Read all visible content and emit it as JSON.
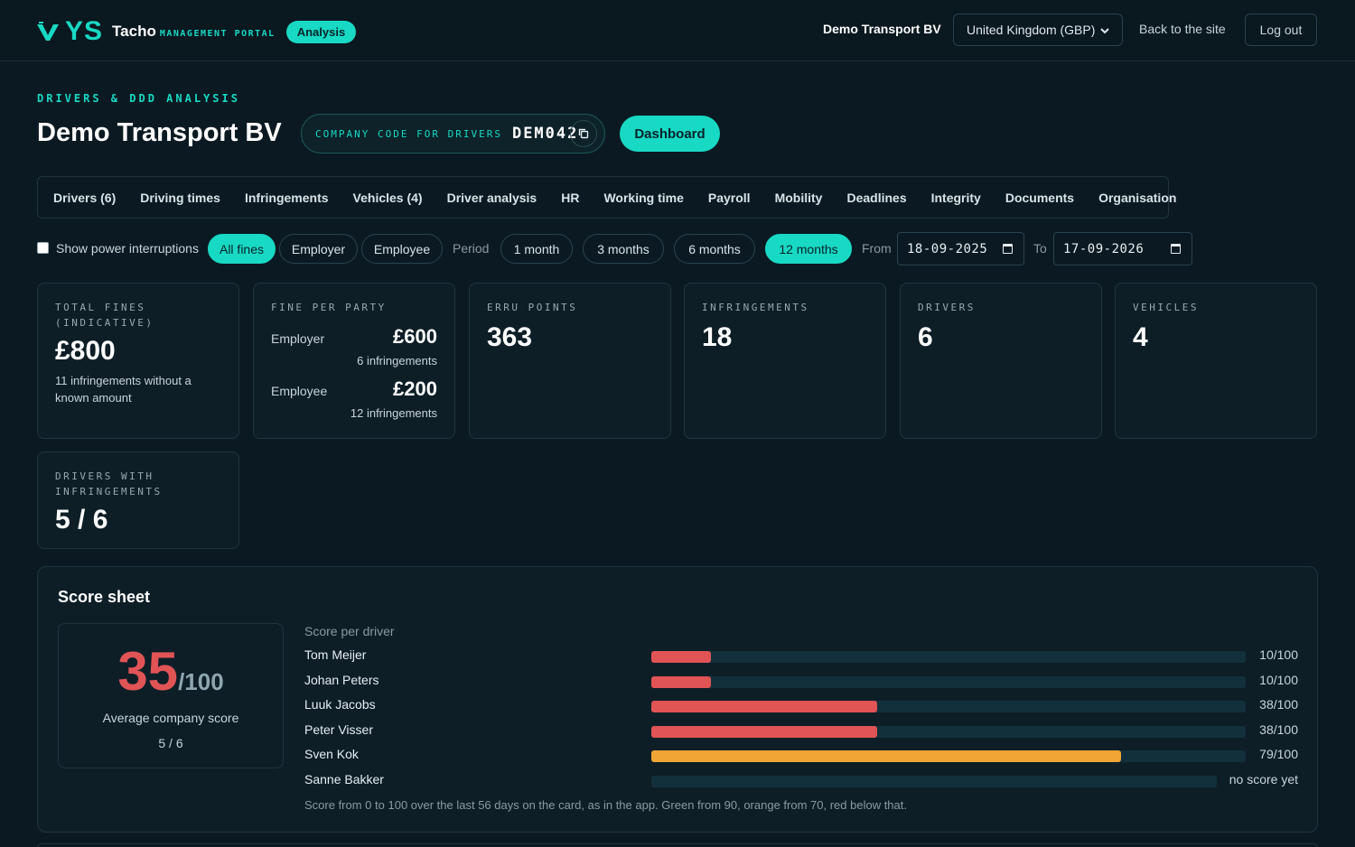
{
  "topbar": {
    "logo_text": "YS",
    "product": "Tacho",
    "product_sub": "MANAGEMENT PORTAL",
    "section_badge": "Analysis",
    "company": "Demo Transport BV",
    "country_select": "United Kingdom (GBP)",
    "back_link": "Back to the site",
    "logout": "Log out"
  },
  "header": {
    "eyebrow": "DRIVERS & DDD ANALYSIS",
    "title": "Demo Transport BV",
    "code_label": "COMPANY CODE FOR DRIVERS",
    "code_value": "DEM042",
    "dashboard_button": "Dashboard"
  },
  "tabs": [
    "Drivers (6)",
    "Driving times",
    "Infringements",
    "Vehicles (4)",
    "Driver analysis",
    "HR",
    "Working time",
    "Payroll",
    "Mobility",
    "Deadlines",
    "Integrity",
    "Documents",
    "Organisation"
  ],
  "filters": {
    "power_label": "Show power interruptions",
    "fine_filters": [
      "All fines",
      "Employer",
      "Employee"
    ],
    "active_fine_filter": "All fines",
    "period_label": "Period",
    "periods": [
      "1 month",
      "3 months",
      "6 months",
      "12 months"
    ],
    "active_period": "12 months",
    "from_label": "From",
    "from_value": "18-09-2025",
    "to_label": "To",
    "to_value": "17-09-2026"
  },
  "stats": {
    "total_fines": {
      "label": "TOTAL FINES (INDICATIVE)",
      "value": "£800",
      "note": "11 infringements without a known amount"
    },
    "fine_per_party": {
      "label": "FINE PER PARTY",
      "employer": {
        "name": "Employer",
        "amount": "£600",
        "count": "6 infringements"
      },
      "employee": {
        "name": "Employee",
        "amount": "£200",
        "count": "12 infringements"
      }
    },
    "erru": {
      "label": "ERRU POINTS",
      "value": "363"
    },
    "infringements": {
      "label": "INFRINGEMENTS",
      "value": "18"
    },
    "drivers": {
      "label": "DRIVERS",
      "value": "6"
    },
    "vehicles": {
      "label": "VEHICLES",
      "value": "4"
    },
    "drivers_with_inf": {
      "label": "DRIVERS WITH INFRINGEMENTS",
      "value": "5 / 6"
    }
  },
  "score_sheet": {
    "title": "Score sheet",
    "avg_score": "35",
    "avg_denominator": "/100",
    "avg_label": "Average company score",
    "avg_count": "5 / 6",
    "per_driver_label": "Score per driver",
    "drivers": [
      {
        "name": "Tom Meijer",
        "score": 10,
        "score_text": "10/100",
        "color": "#e05456"
      },
      {
        "name": "Johan Peters",
        "score": 10,
        "score_text": "10/100",
        "color": "#e05456"
      },
      {
        "name": "Luuk Jacobs",
        "score": 38,
        "score_text": "38/100",
        "color": "#e05456"
      },
      {
        "name": "Peter Visser",
        "score": 38,
        "score_text": "38/100",
        "color": "#e05456"
      },
      {
        "name": "Sven Kok",
        "score": 79,
        "score_text": "79/100",
        "color": "#f0a534"
      },
      {
        "name": "Sanne Bakker",
        "score": null,
        "score_text": "no score yet",
        "color": "#12303b"
      }
    ],
    "footnote": "Score from 0 to 100 over the last 56 days on the card, as in the app. Green from 90, orange from 70, red below that."
  },
  "colors": {
    "accent": "#18d9c4",
    "red": "#e05456",
    "orange": "#f0a534",
    "background": "#0b1a22"
  }
}
